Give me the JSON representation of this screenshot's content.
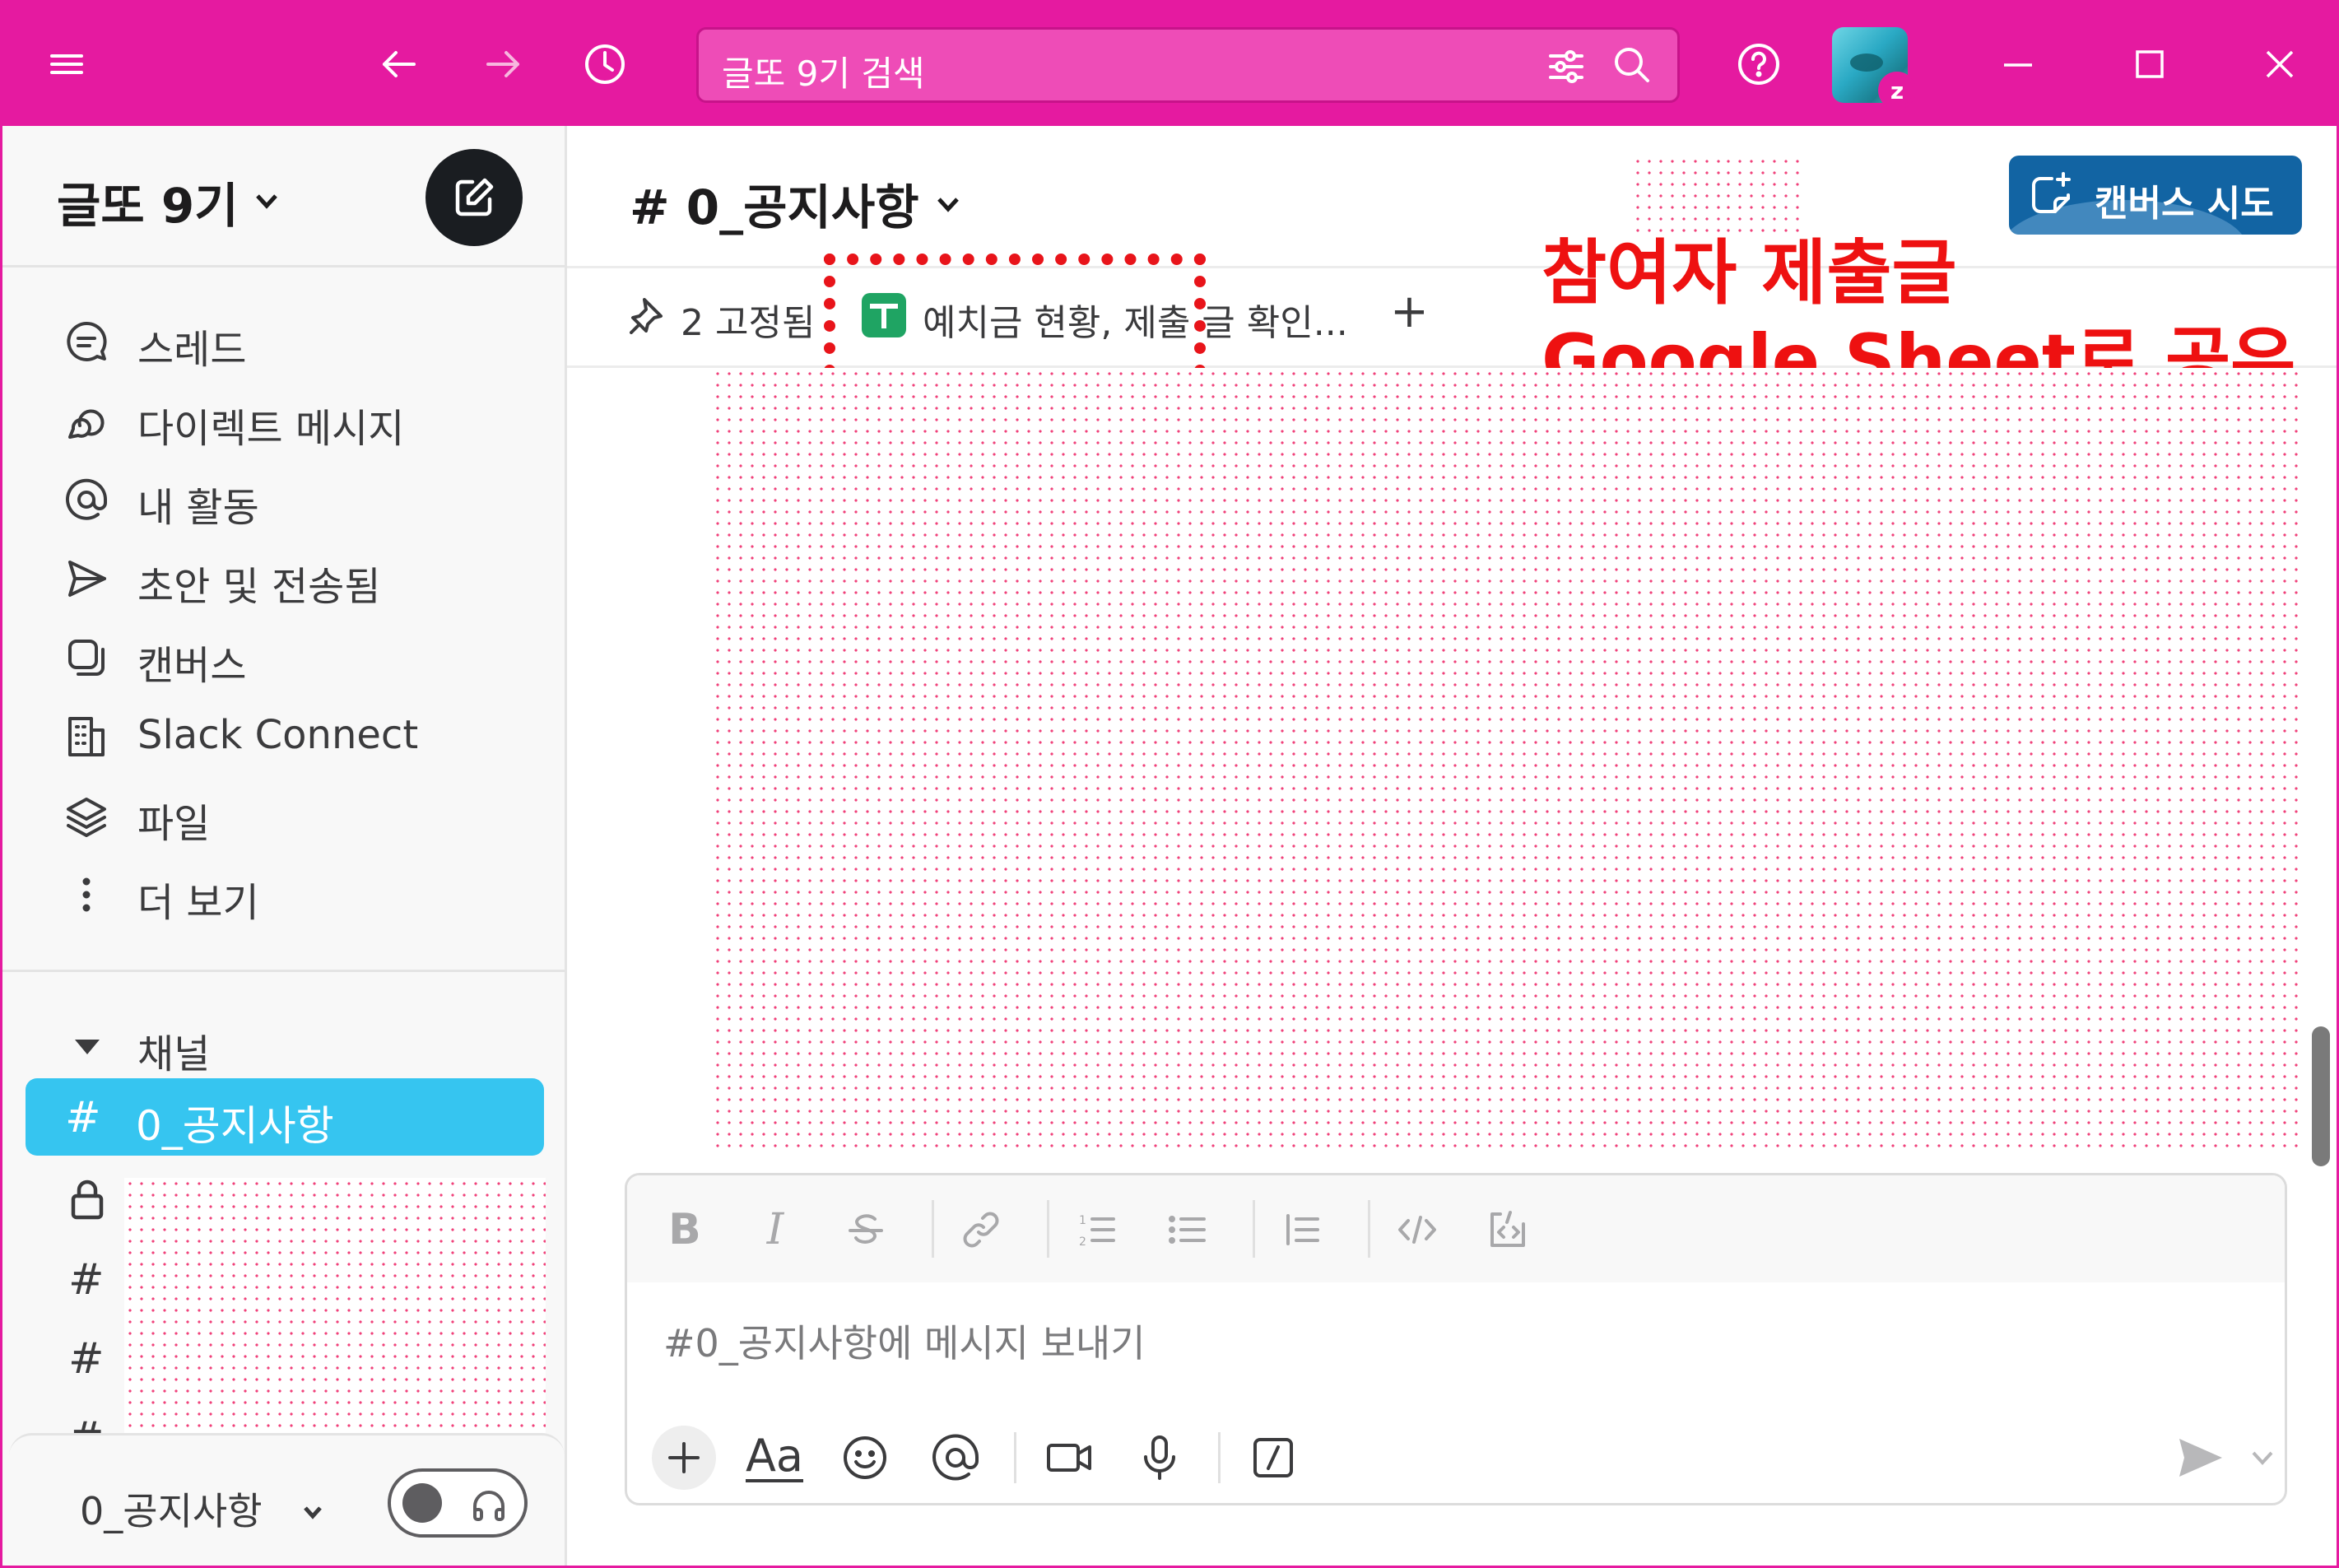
{
  "titlebar": {
    "bg_color": "#e51aa0",
    "search_placeholder": "글또 9기 검색",
    "icons": [
      "menu-icon",
      "back-icon",
      "forward-icon",
      "history-icon",
      "filter-icon",
      "search-icon",
      "help-icon",
      "minimize-icon",
      "maximize-icon",
      "close-icon"
    ]
  },
  "workspace": {
    "name": "글또 9기"
  },
  "sidebar": {
    "nav": [
      {
        "label": "스레드",
        "icon": "threads-icon"
      },
      {
        "label": "다이렉트 메시지",
        "icon": "direct-messages-icon"
      },
      {
        "label": "내 활동",
        "icon": "mention-icon"
      },
      {
        "label": "초안 및 전송됨",
        "icon": "send-icon"
      },
      {
        "label": "캔버스",
        "icon": "canvas-icon"
      },
      {
        "label": "Slack Connect",
        "icon": "building-icon"
      },
      {
        "label": "파일",
        "icon": "layers-icon"
      },
      {
        "label": "더 보기",
        "icon": "more-vertical-icon"
      }
    ],
    "section_label": "채널",
    "channels": [
      {
        "prefix": "#",
        "name": "0_공지사항",
        "active": true
      },
      {
        "prefix": "lock",
        "name": ""
      },
      {
        "prefix": "#",
        "name": ""
      },
      {
        "prefix": "#",
        "name": ""
      }
    ],
    "footer": {
      "channel": "0_공지사항"
    }
  },
  "channel": {
    "title": "# 0_공지사항",
    "canvas_button": "캔버스 시도",
    "pinned_label": "2 고정됨",
    "bookmark_label": "예치금 현황, 제출 글 확인...",
    "bookmark_add": "+"
  },
  "annotation": {
    "line1": "참여자 제출글",
    "line2": "Google Sheet로 공유",
    "color": "#ee1111"
  },
  "composer": {
    "placeholder": "#0_공지사항에 메시지 보내기",
    "aa_label": "Aa"
  },
  "colors": {
    "accent": "#e51aa0",
    "active_channel": "#36c5f0",
    "canvas_button": "#1264a3",
    "sheets_green": "#1fa463"
  }
}
